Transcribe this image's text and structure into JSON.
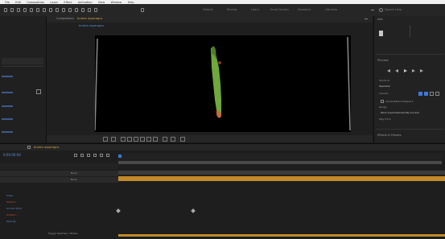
{
  "menubar": {
    "items": [
      "File",
      "Edit",
      "Composition",
      "Layer",
      "Effect",
      "Animation",
      "View",
      "Window",
      "Help"
    ]
  },
  "toolbar": {
    "workspace_items": [
      "Default",
      "Review",
      "Learn",
      "Small Screen",
      "Standard",
      "Libraries"
    ],
    "search_placeholder": "Search Help"
  },
  "comp_panel": {
    "tab_title": "Composition",
    "comp_name": "broken asparagus"
  },
  "right_panel": {
    "info_tab": "Info",
    "preview_tab": "Preview",
    "shortcut_label": "Shortcut",
    "shortcut_value": "Spacebar",
    "include_label": "Include:",
    "cache_label": "Cache Before Playback",
    "range_label": "Range",
    "range_value": "Work Area Extended By Current",
    "play_from_label": "Play From",
    "effects_tab": "Effects & Presets"
  },
  "timeline": {
    "tab_title": "broken asparagus",
    "timecode": "0:00:00:00",
    "layer_rows": [
      "Scale",
      "Position",
      "Anchor Point",
      "Rotation",
      "Opacity"
    ],
    "mode_labels": [
      "None",
      "None"
    ],
    "toggle_label": "Toggle Switches / Modes"
  },
  "colors": {
    "accent": "#3b78d8",
    "work_area": "#c28a2b",
    "asparagus_green": "#6fa83b"
  }
}
